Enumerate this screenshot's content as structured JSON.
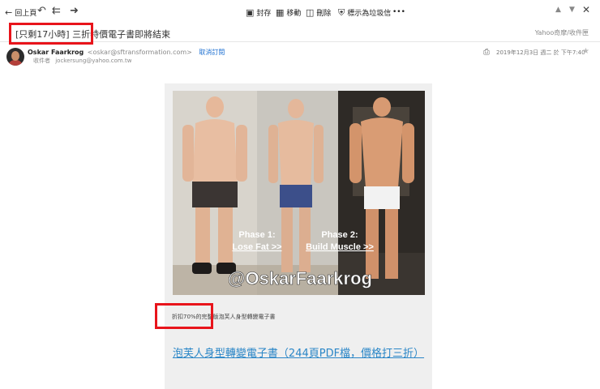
{
  "toolbar": {
    "back_label": "回上頁",
    "archive_label": "封存",
    "move_label": "移動",
    "delete_label": "刪除",
    "spam_label": "標示為垃圾信",
    "more_label": "•••"
  },
  "email": {
    "subject": "[只剩17小時] 三折特價電子書即將結束",
    "folder": "Yahoo奇摩/收件匣",
    "sender_name": "Oskar Faarkrog",
    "sender_email": "<oskar@sftransformation.com>",
    "unsubscribe_label": "取消訂閱",
    "to_label": "收件者",
    "to_address": "jockersung@yahoo.com.tw",
    "date": "2019年12月3日 週二 於 下午7:40"
  },
  "body": {
    "photo": {
      "phase1_line1": "Phase 1:",
      "phase1_line2": "Lose Fat >>",
      "phase2_line1": "Phase 2:",
      "phase2_line2": "Build Muscle >>",
      "handle": "@OskarFaarkrog"
    },
    "caption": "折扣70%的完整版泡芙人身型轉變電子書",
    "link_text": "泡芙人身型轉變電子書（244頁PDF檔，價格打三折）"
  },
  "colors": {
    "highlight_box": "#e8141b",
    "link": "#2a86c7",
    "panel": "#efefef"
  }
}
